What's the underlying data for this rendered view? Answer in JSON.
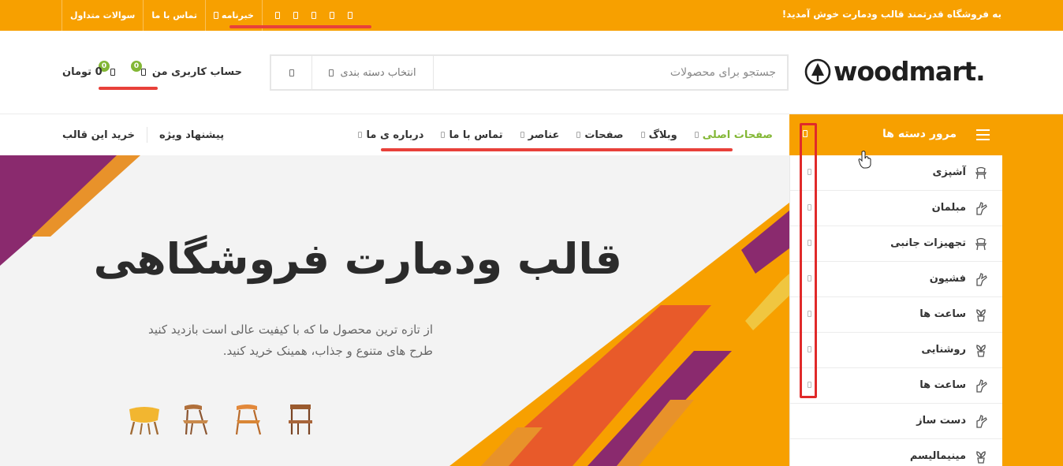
{
  "topbar": {
    "welcome": "به فروشگاه قدرتمند قالب ودمارت خوش آمدید!",
    "links": [
      "سوالات متداول",
      "تماس با ما",
      "خبرنامه"
    ],
    "social_icons": [
      "facebook-icon",
      "twitter-icon",
      "instagram-icon",
      "pinterest-icon",
      "youtube-icon"
    ]
  },
  "header": {
    "logo": "woodmart.",
    "search": {
      "placeholder": "جستجو برای محصولات",
      "category": "انتخاب دسته بندی"
    },
    "account": "حساب کاربری من",
    "wishlist_count": "0",
    "cart_count": "0",
    "cart_total": "0 تومان"
  },
  "nav": {
    "categories_title": "مرور دسته ها",
    "menu": [
      "صفحات اصلی",
      "وبلاگ",
      "صفحات",
      "عناصر",
      "تماس با ما",
      "درباره ی ما"
    ],
    "right_links": [
      "خرید این قالب",
      "پیشنهاد ویژه"
    ]
  },
  "hero": {
    "title": "قالب ودمارت فروشگاهی",
    "subtitle": "از تازه ترین محصول ما که با کیفیت عالی است بازدید کنید طرح های متنوع و جذاب، همینک خرید کنید."
  },
  "categories": [
    {
      "label": "آشپزی",
      "icon": "chair-icon"
    },
    {
      "label": "مبلمان",
      "icon": "hand-icon"
    },
    {
      "label": "تجهیزات جانبی",
      "icon": "chair-icon"
    },
    {
      "label": "فشیون",
      "icon": "hand-icon"
    },
    {
      "label": "ساعت ها",
      "icon": "plant-icon"
    },
    {
      "label": "روشنایی",
      "icon": "plant-icon"
    },
    {
      "label": "ساعت ها",
      "icon": "hand-icon"
    },
    {
      "label": "دست ساز",
      "icon": "hand-icon"
    },
    {
      "label": "مینیمالیسم",
      "icon": "plant-icon"
    }
  ],
  "colors": {
    "accent": "#f7a000",
    "green": "#83b735",
    "purple": "#8a2a6e",
    "red_annotation": "#e8413a"
  }
}
